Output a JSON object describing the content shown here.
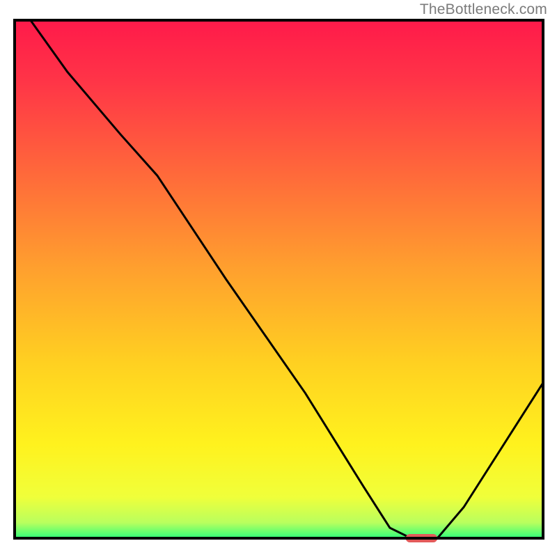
{
  "watermark": "TheBottleneck.com",
  "colors": {
    "curve": "#000000",
    "marker": "#e25a5a",
    "border": "#000000",
    "gradient_stops": [
      {
        "offset": 0.0,
        "color": "#ff1a4a"
      },
      {
        "offset": 0.12,
        "color": "#ff3547"
      },
      {
        "offset": 0.3,
        "color": "#ff6a3a"
      },
      {
        "offset": 0.48,
        "color": "#ffa02e"
      },
      {
        "offset": 0.66,
        "color": "#ffd021"
      },
      {
        "offset": 0.82,
        "color": "#fff21e"
      },
      {
        "offset": 0.92,
        "color": "#f0ff3a"
      },
      {
        "offset": 0.97,
        "color": "#b9ff5e"
      },
      {
        "offset": 1.0,
        "color": "#2fff7a"
      }
    ]
  },
  "chart_data": {
    "type": "line",
    "title": "",
    "xlabel": "",
    "ylabel": "",
    "xlim": [
      0,
      100
    ],
    "ylim": [
      0,
      100
    ],
    "x": [
      3,
      10,
      20,
      27,
      40,
      55,
      66,
      71,
      75,
      80,
      85,
      100
    ],
    "values": [
      100,
      90,
      78,
      70,
      50,
      28,
      10,
      2,
      0,
      0,
      6,
      30
    ],
    "marker_at": {
      "x_start": 74,
      "x_end": 80,
      "y": 0
    },
    "annotations": []
  }
}
